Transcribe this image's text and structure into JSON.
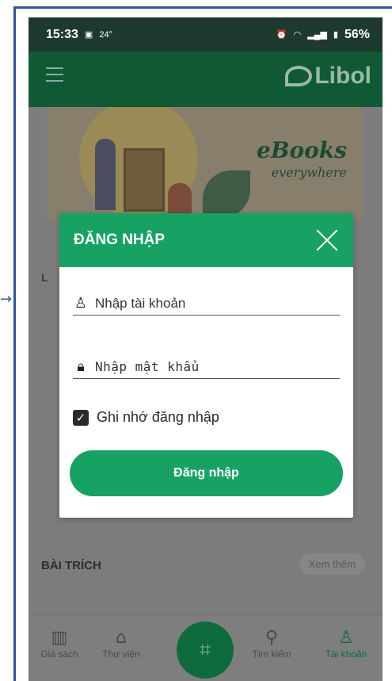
{
  "status_bar": {
    "time": "15:33",
    "temp": "24°",
    "battery": "56%"
  },
  "banner": {
    "title": "eBooks",
    "subtitle": "everywhere"
  },
  "app": {
    "logo_text": "Libol"
  },
  "section": {
    "partial_label": "L",
    "excerpts_title": "BÀI TRÍCH",
    "see_more": "Xem thêm"
  },
  "dialog": {
    "title": "ĐĂNG NHẬP",
    "username_placeholder": "Nhập tài khoản",
    "password_placeholder": "Nhập mật khẩu",
    "remember_label": "Ghi nhớ đăng nhập",
    "remember_checked": true,
    "login_button": "Đăng nhập"
  },
  "bottom_nav": {
    "items": [
      {
        "label": "Giá sách",
        "icon": "bookshelf-icon"
      },
      {
        "label": "Thư viện",
        "icon": "library-icon"
      },
      {
        "label": "Tìm kiếm",
        "icon": "search-icon"
      },
      {
        "label": "Tài khoản",
        "icon": "user-icon",
        "active": true
      }
    ],
    "center_icon": "qr-scan-icon"
  },
  "colors": {
    "primary_green": "#17a264",
    "dark_green": "#0f5a35",
    "frame_blue": "#2f5597"
  }
}
